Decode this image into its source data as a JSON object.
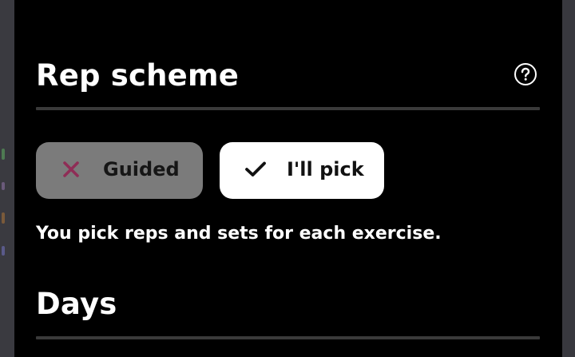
{
  "rep_scheme": {
    "title": "Rep scheme",
    "help_icon": "question-circle-icon",
    "options": [
      {
        "label": "Guided",
        "icon": "x-icon",
        "selected": false,
        "icon_color": "#8f2d56"
      },
      {
        "label": "I'll pick",
        "icon": "checkmark-icon",
        "selected": true,
        "icon_color": "#111111"
      }
    ],
    "description": "You pick reps and sets for each exercise."
  },
  "days": {
    "title": "Days"
  },
  "colors": {
    "panel_background": "#000000",
    "divider": "#3a3a3a",
    "chip_selected": "#ffffff",
    "chip_unselected": "#7b7b7b"
  }
}
